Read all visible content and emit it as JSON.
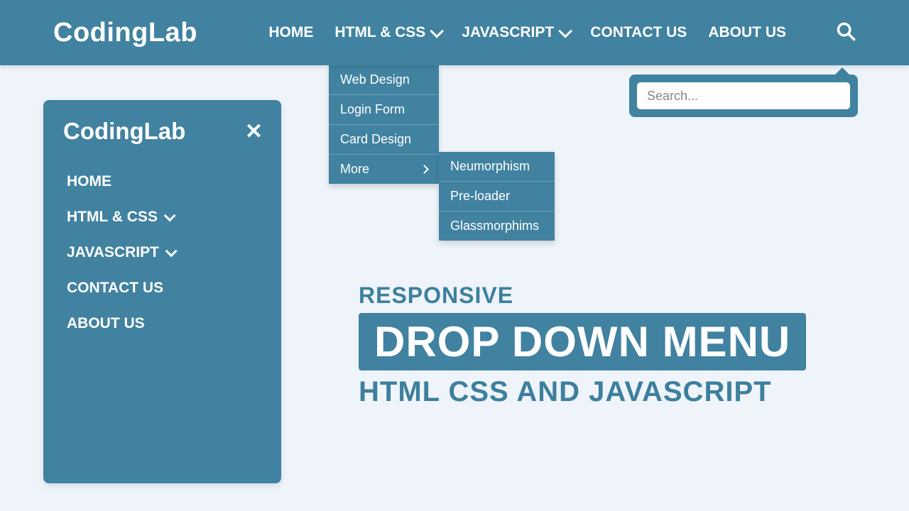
{
  "brand": "CodingLab",
  "nav": {
    "home": "HOME",
    "htmlcss": "HTML & CSS",
    "javascript": "JAVASCRIPT",
    "contact": "CONTACT US",
    "about": "ABOUT US"
  },
  "dropdown": {
    "items": [
      "Web Design",
      "Login Form",
      "Card Design",
      "More"
    ]
  },
  "submenu": {
    "items": [
      "Neumorphism",
      "Pre-loader",
      "Glassmorphims"
    ]
  },
  "search": {
    "placeholder": "Search..."
  },
  "sidebar": {
    "logo": "CodingLab",
    "items": {
      "home": "HOME",
      "htmlcss": "HTML & CSS",
      "javascript": "JAVASCRIPT",
      "contact": "CONTACT US",
      "about": "ABOUT US"
    }
  },
  "hero": {
    "sup": "RESPONSIVE",
    "main": "DROP DOWN MENU",
    "sub": "HTML CSS AND JAVASCRIPT"
  }
}
